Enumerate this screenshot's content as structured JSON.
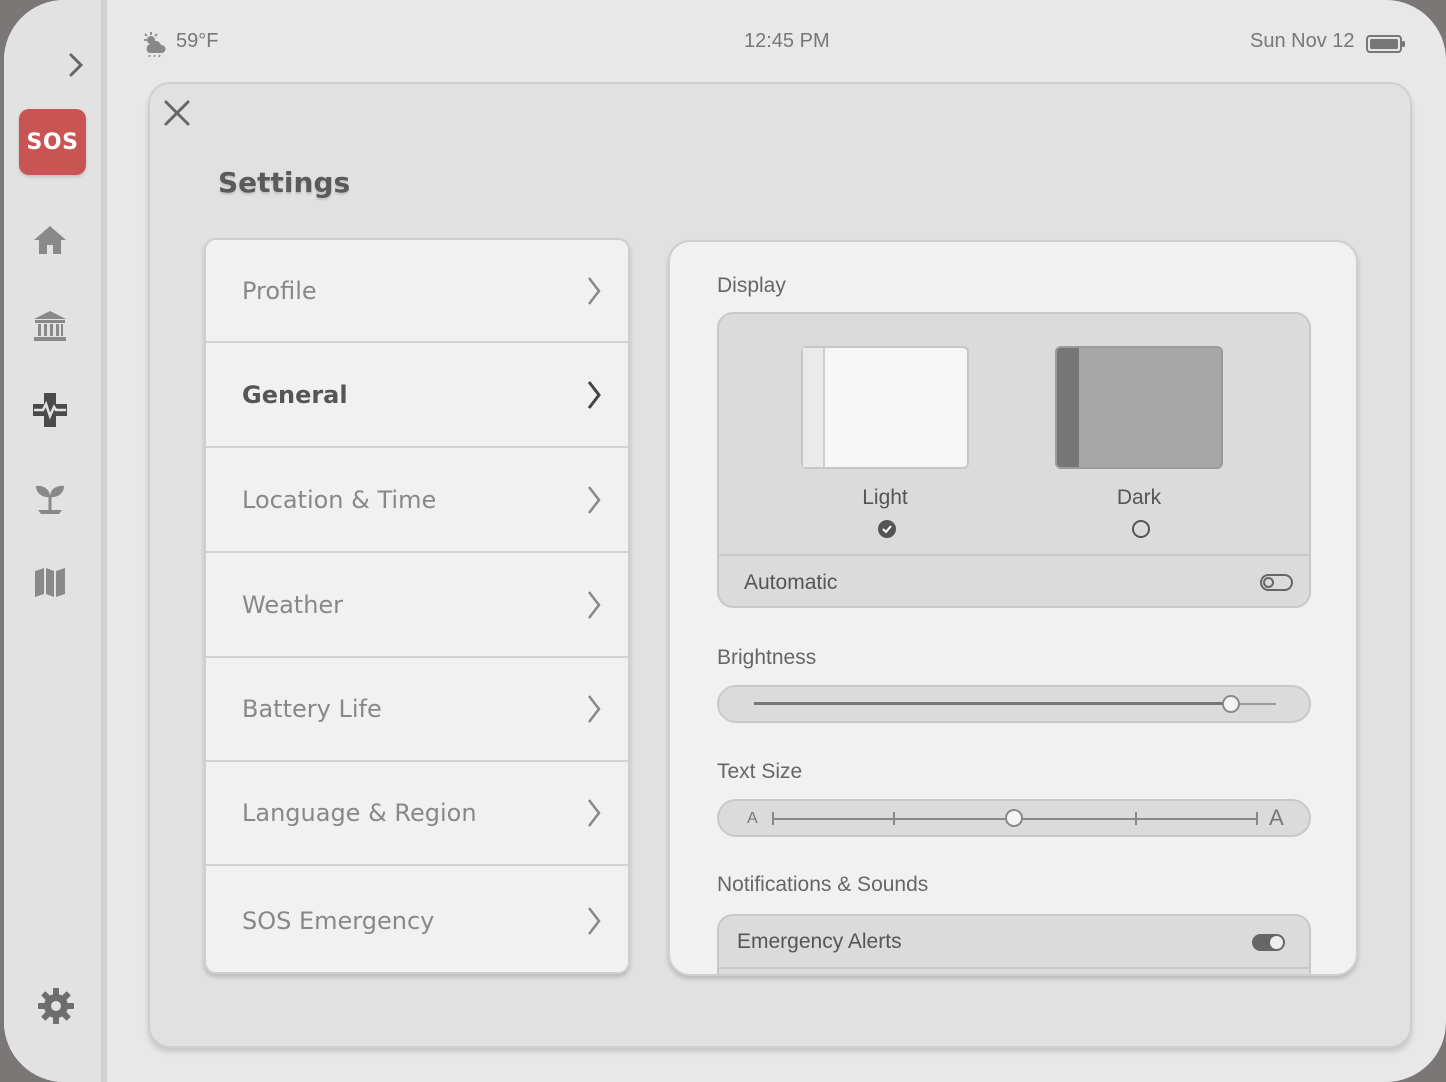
{
  "status_bar": {
    "weather_icon": "cloud-sun-icon",
    "temperature": "59°F",
    "time": "12:45 PM",
    "date": "Sun Nov 12",
    "battery_icon": "battery-icon"
  },
  "rail": {
    "expand_icon": "chevron-right-icon",
    "sos_label": "SOS",
    "sos_color": "#c85454",
    "items": [
      {
        "icon": "home-icon"
      },
      {
        "icon": "bank-icon"
      },
      {
        "icon": "health-icon",
        "active": true
      },
      {
        "icon": "plant-icon"
      },
      {
        "icon": "map-icon"
      }
    ],
    "settings_icon": "gear-icon"
  },
  "settings": {
    "title": "Settings",
    "menu": [
      {
        "label": "Profile"
      },
      {
        "label": "General",
        "active": true
      },
      {
        "label": "Location & Time"
      },
      {
        "label": "Weather"
      },
      {
        "label": "Battery Life"
      },
      {
        "label": "Language & Region"
      },
      {
        "label": "SOS Emergency"
      }
    ],
    "display": {
      "section_label": "Display",
      "light_label": "Light",
      "dark_label": "Dark",
      "selected_theme": "Light",
      "automatic_label": "Automatic",
      "automatic_on": false
    },
    "brightness": {
      "label": "Brightness",
      "value_fraction": 0.915
    },
    "text_size": {
      "label": "Text Size",
      "small_glyph": "A",
      "large_glyph": "A",
      "steps": 5,
      "selected_step": 3
    },
    "notifications": {
      "section_label": "Notifications & Sounds",
      "emergency_alerts_label": "Emergency Alerts",
      "emergency_alerts_on": true
    }
  }
}
